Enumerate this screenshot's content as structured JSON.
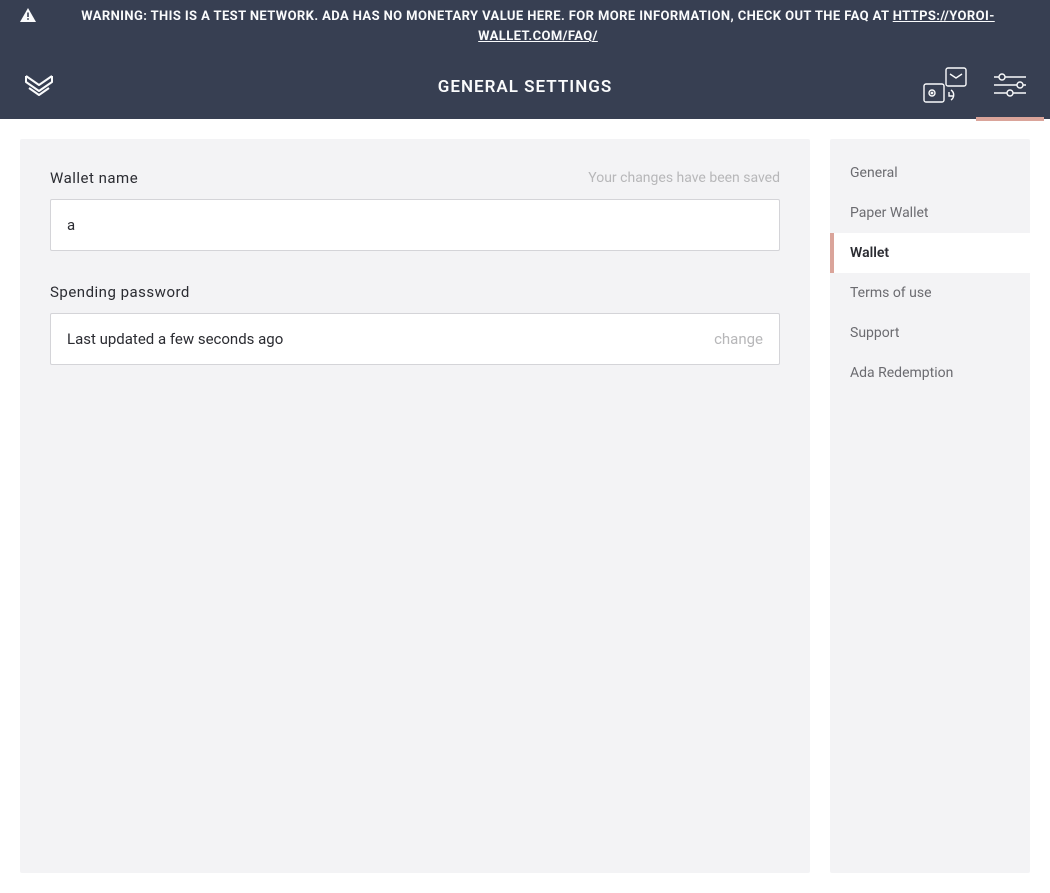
{
  "banner": {
    "warning_prefix": "WARNING: THIS IS A TEST NETWORK. ADA HAS NO MONETARY VALUE HERE. FOR MORE INFORMATION, CHECK OUT THE FAQ AT ",
    "faq_link": "HTTPS://YOROI-WALLET.COM/FAQ/"
  },
  "header": {
    "title": "GENERAL SETTINGS"
  },
  "main": {
    "wallet_name_label": "Wallet name",
    "wallet_name_hint": "Your changes have been saved",
    "wallet_name_value": "a",
    "spending_password_label": "Spending password",
    "spending_password_status": "Last updated a few seconds ago",
    "change_label": "change"
  },
  "sidebar": {
    "items": [
      {
        "label": "General",
        "active": false
      },
      {
        "label": "Paper Wallet",
        "active": false
      },
      {
        "label": "Wallet",
        "active": true
      },
      {
        "label": "Terms of use",
        "active": false
      },
      {
        "label": "Support",
        "active": false
      },
      {
        "label": "Ada Redemption",
        "active": false
      }
    ]
  },
  "icons": {
    "logo": "yoroi-logo",
    "wallets": "wallets-icon",
    "settings": "settings-sliders-icon",
    "warning": "warning-triangle-icon"
  }
}
